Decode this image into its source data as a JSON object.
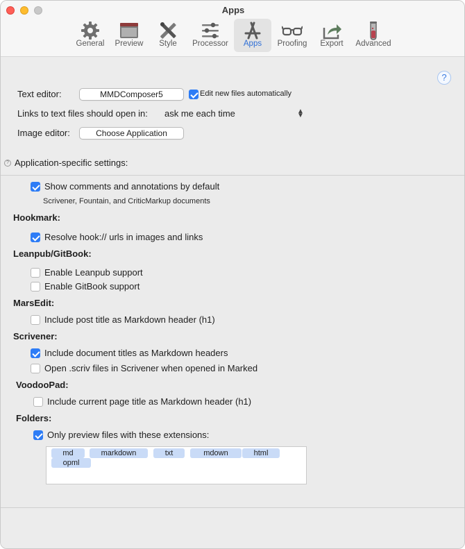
{
  "window": {
    "title": "Apps"
  },
  "toolbar": {
    "items": [
      {
        "label": "General",
        "icon": "gear-icon"
      },
      {
        "label": "Preview",
        "icon": "window-icon"
      },
      {
        "label": "Style",
        "icon": "paintbrush-ruler-icon"
      },
      {
        "label": "Processor",
        "icon": "sliders-icon"
      },
      {
        "label": "Apps",
        "icon": "app-store-icon",
        "active": true
      },
      {
        "label": "Proofing",
        "icon": "glasses-icon"
      },
      {
        "label": "Export",
        "icon": "share-icon"
      },
      {
        "label": "Advanced",
        "icon": "test-tube-icon"
      }
    ]
  },
  "help": {
    "symbol": "?"
  },
  "editors": {
    "text_editor_label": "Text editor:",
    "text_editor_value": "MMDComposer5",
    "edit_new_files_label": "Edit new files automatically",
    "edit_new_files_checked": true,
    "links_label": "Links to text files should open in:",
    "links_value": "ask me each time",
    "image_editor_label": "Image editor:",
    "image_editor_button": "Choose Application"
  },
  "app_specific": {
    "header": "Application-specific settings:"
  },
  "settings": {
    "show_comments": {
      "label": "Show comments and annotations by default",
      "checked": true
    },
    "show_comments_note": "Scrivener, Fountain, and CriticMarkup documents",
    "hookmark": {
      "header": "Hookmark:",
      "resolve_hook": {
        "label": "Resolve hook:// urls in images and links",
        "checked": true
      }
    },
    "leanpub": {
      "header": "Leanpub/GitBook:",
      "enable_leanpub": {
        "label": "Enable Leanpub support",
        "checked": false
      },
      "enable_gitbook": {
        "label": "Enable GitBook support",
        "checked": false
      }
    },
    "marsedit": {
      "header": "MarsEdit:",
      "include_post_title": {
        "label": "Include post title as Markdown header (h1)",
        "checked": false
      }
    },
    "scrivener": {
      "header": "Scrivener:",
      "include_doc_titles": {
        "label": "Include document titles as Markdown headers",
        "checked": true
      },
      "open_scriv": {
        "label": "Open .scriv files in Scrivener when opened in Marked",
        "checked": false
      }
    },
    "voodoopad": {
      "header": "VoodooPad:",
      "include_page_title": {
        "label": "Include current page title as Markdown header (h1)",
        "checked": false
      }
    },
    "folders": {
      "header": "Folders:",
      "only_preview": {
        "label": "Only preview files with these extensions:",
        "checked": true
      },
      "extensions": [
        "md",
        "markdown",
        "txt",
        "mdown",
        "html",
        "opml"
      ]
    }
  },
  "colors": {
    "accent": "#2d7cf6",
    "token": "#c9dbf7",
    "active_label": "#2f6fd6"
  }
}
